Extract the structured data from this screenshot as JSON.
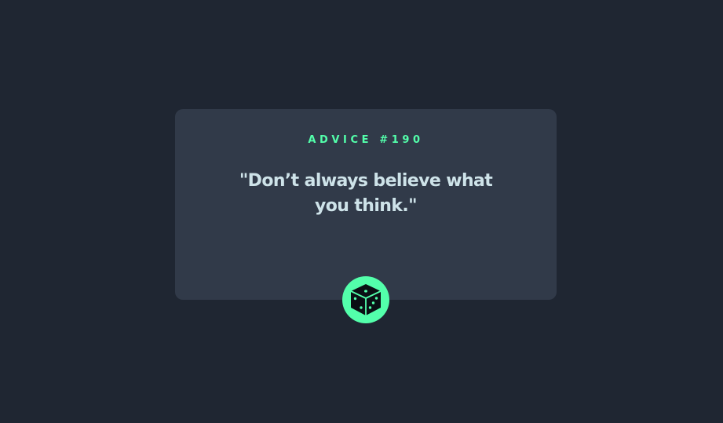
{
  "card": {
    "advice_id": "ADVICE #190",
    "quote": "\"Don’t always believe what you think.\""
  },
  "dice_button": {
    "icon": "dice-icon"
  },
  "colors": {
    "background": "#1f2632",
    "card": "#313a49",
    "accent": "#53ffab",
    "quote_text": "#cee3e9"
  }
}
